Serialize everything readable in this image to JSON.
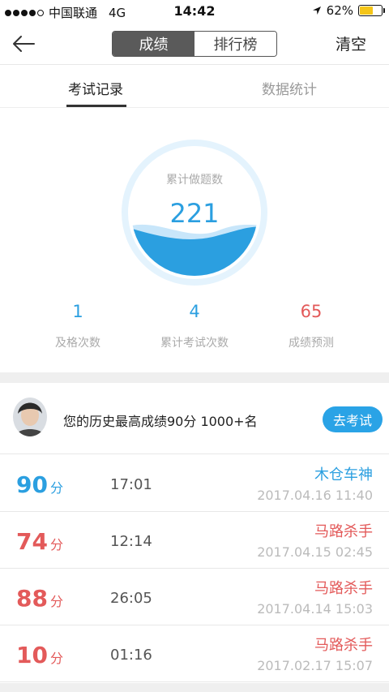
{
  "status_bar": {
    "carrier": "中国联通",
    "network": "4G",
    "time": "14:42",
    "battery": "62%",
    "battery_level": 0.62
  },
  "nav": {
    "segments": [
      "成绩",
      "排行榜"
    ],
    "active_segment": "成绩",
    "right_action": "清空"
  },
  "tabs": [
    "考试记录",
    "数据统计"
  ],
  "gauge": {
    "label": "累计做题数",
    "value": "221",
    "wave_color": "#2b9fe0"
  },
  "stats": [
    {
      "value": "1",
      "label": "及格次数",
      "color": "blue"
    },
    {
      "value": "4",
      "label": "累计考试次数",
      "color": "blue"
    },
    {
      "value": "65",
      "label": "成绩预测",
      "color": "red"
    }
  ],
  "best": {
    "text": "您的历史最高成绩90分 1000+名",
    "button": "去考试"
  },
  "score_unit": "分",
  "records": [
    {
      "score": "90",
      "duration": "17:01",
      "name": "木仓车神",
      "date": "2017.04.16 11:40",
      "color": "blue"
    },
    {
      "score": "74",
      "duration": "12:14",
      "name": "马路杀手",
      "date": "2017.04.15 02:45",
      "color": "red"
    },
    {
      "score": "88",
      "duration": "26:05",
      "name": "马路杀手",
      "date": "2017.04.14 15:03",
      "color": "red"
    },
    {
      "score": "10",
      "duration": "01:16",
      "name": "马路杀手",
      "date": "2017.02.17 15:07",
      "color": "red"
    }
  ],
  "colors": {
    "blue": "#2b9fe0",
    "red": "#e35a5a",
    "button_blue": "#2aa3e6"
  }
}
